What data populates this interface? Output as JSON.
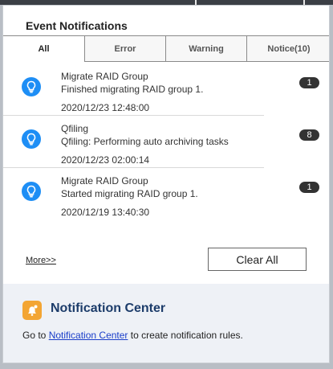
{
  "panel": {
    "title": "Event Notifications"
  },
  "tabs": [
    {
      "label": "All"
    },
    {
      "label": "Error"
    },
    {
      "label": "Warning"
    },
    {
      "label": "Notice(10)"
    }
  ],
  "notifications": [
    {
      "title": "Migrate RAID Group",
      "message": "Finished migrating RAID group 1.",
      "time": "2020/12/23 12:48:00",
      "count": "1",
      "icon": "lightbulb-icon"
    },
    {
      "title": "Qfiling",
      "message": "Qfiling: Performing auto archiving tasks",
      "time": "2020/12/23 02:00:14",
      "count": "8",
      "icon": "lightbulb-icon"
    },
    {
      "title": "Migrate RAID Group",
      "message": "Started migrating RAID group 1.",
      "time": "2020/12/19 13:40:30",
      "count": "1",
      "icon": "lightbulb-icon"
    }
  ],
  "actions": {
    "more": "More>>",
    "clear_all": "Clear All"
  },
  "footer": {
    "title": "Notification Center",
    "text_before": "Go to",
    "link": "Notification Center",
    "text_after": "to create notification rules."
  },
  "colors": {
    "accent": "#1e8ef5",
    "badge": "#333333",
    "footer_bg": "#eef1f6",
    "footer_title": "#1c3c6a",
    "link": "#1a3ec9",
    "nc_icon": "#f3a533"
  }
}
